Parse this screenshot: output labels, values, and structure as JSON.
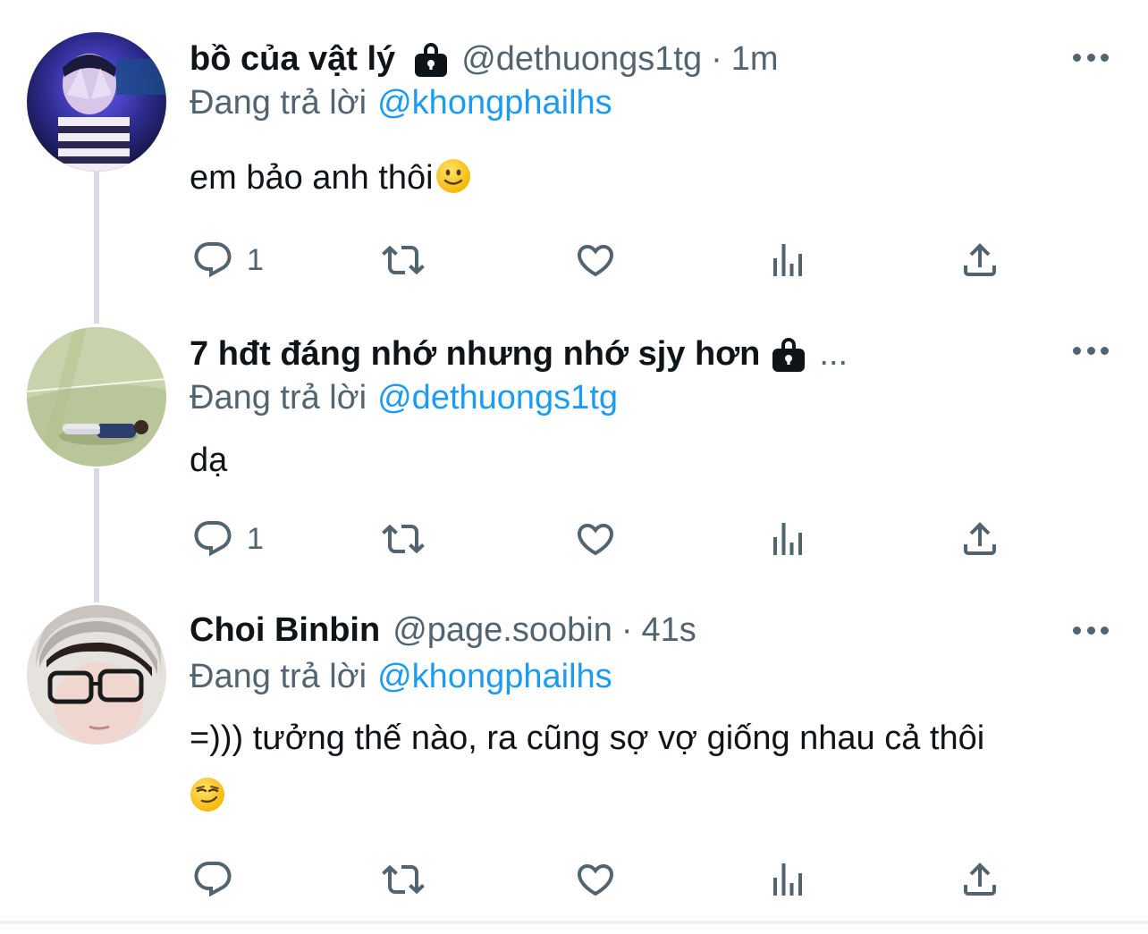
{
  "tweets": [
    {
      "name": "bồ của vật lý",
      "protected": true,
      "handle": "@dethuongs1tg",
      "separator": "·",
      "time": "1m",
      "reply_label": "Đang trả lời",
      "reply_to": "@khongphailhs",
      "text": "em bảo anh thôi",
      "emoji": "slightly-smiling-face-emoji",
      "replies": "1",
      "avatar": "person-in-purple-light-avatar"
    },
    {
      "name": "7 hđt đáng nhớ nhưng nhớ sjy hơn",
      "protected": true,
      "truncated": "...",
      "reply_label": "Đang trả lời",
      "reply_to": "@dethuongs1tg",
      "text": "dạ",
      "replies": "1",
      "avatar": "person-lying-on-grass-avatar"
    },
    {
      "name": "Choi Binbin",
      "handle": "@page.soobin",
      "separator": "·",
      "time": "41s",
      "reply_label": "Đang trả lời",
      "reply_to": "@khongphailhs",
      "text_line1": "=))) tưởng thế nào, ra cũng sợ vợ giống nhau cả thôi",
      "emoji": "smirking-face-emoji",
      "replies": "",
      "avatar": "person-with-glasses-avatar"
    }
  ],
  "icons": {
    "reply": "reply-icon",
    "retweet": "retweet-icon",
    "like": "like-icon",
    "analytics": "analytics-icon",
    "share": "share-icon",
    "more": "more-icon",
    "lock": "lock-icon"
  },
  "colors": {
    "link": "#1d9bf0",
    "secondary": "#536471",
    "thread_line": "#d9dde1"
  }
}
